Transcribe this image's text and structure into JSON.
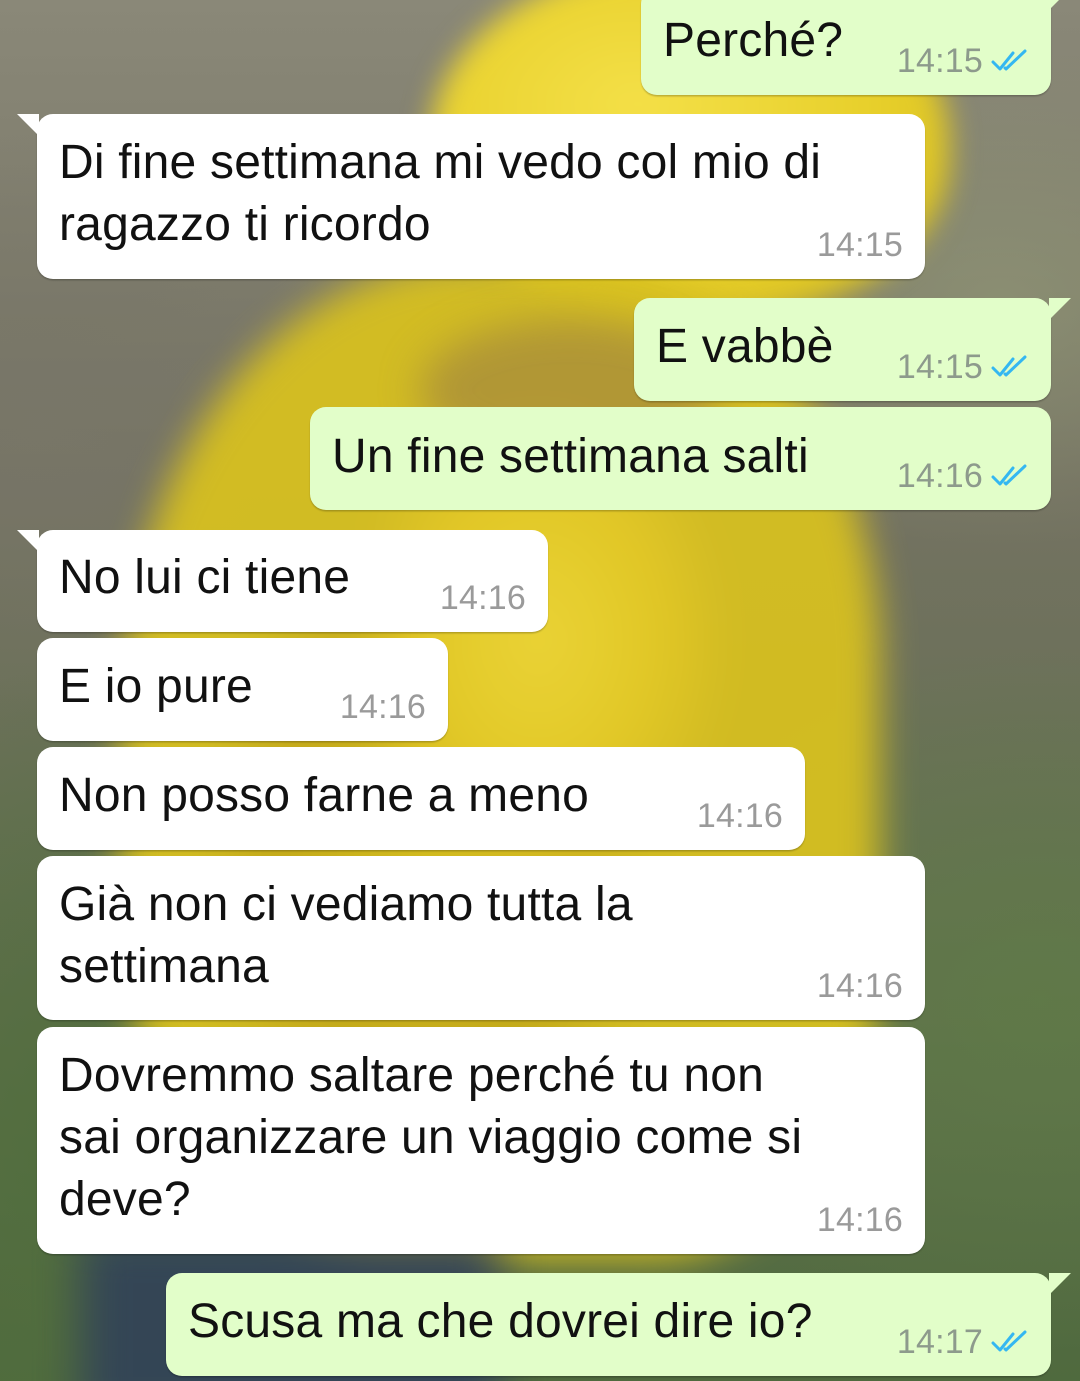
{
  "chat": {
    "colors": {
      "incoming_bubble": "#ffffff",
      "outgoing_bubble": "#e2fec9",
      "read_ticks": "#34b7f1",
      "timestamp": "#9a9a9a"
    },
    "read_icon": "double-check-icon",
    "messages": [
      {
        "direction": "outgoing",
        "lines": [
          "Perché?"
        ],
        "time": "14:15",
        "status": "read"
      },
      {
        "direction": "incoming",
        "lines": [
          "Di fine settimana mi vedo col mio di",
          "ragazzo ti ricordo"
        ],
        "time": "14:15"
      },
      {
        "direction": "outgoing",
        "lines": [
          "E vabbè"
        ],
        "time": "14:15",
        "status": "read"
      },
      {
        "direction": "outgoing",
        "lines": [
          "Un fine settimana salti"
        ],
        "time": "14:16",
        "status": "read"
      },
      {
        "direction": "incoming",
        "lines": [
          "No lui ci tiene"
        ],
        "time": "14:16"
      },
      {
        "direction": "incoming",
        "lines": [
          "E io pure"
        ],
        "time": "14:16"
      },
      {
        "direction": "incoming",
        "lines": [
          "Non posso farne a meno"
        ],
        "time": "14:16"
      },
      {
        "direction": "incoming",
        "lines": [
          "Già non ci vediamo tutta la",
          "settimana"
        ],
        "time": "14:16"
      },
      {
        "direction": "incoming",
        "lines": [
          "Dovremmo saltare perché tu non",
          "sai organizzare un viaggio come si",
          "deve?"
        ],
        "time": "14:16"
      },
      {
        "direction": "outgoing",
        "lines": [
          "Scusa ma che dovrei dire io?"
        ],
        "time": "14:17",
        "status": "read"
      }
    ]
  }
}
